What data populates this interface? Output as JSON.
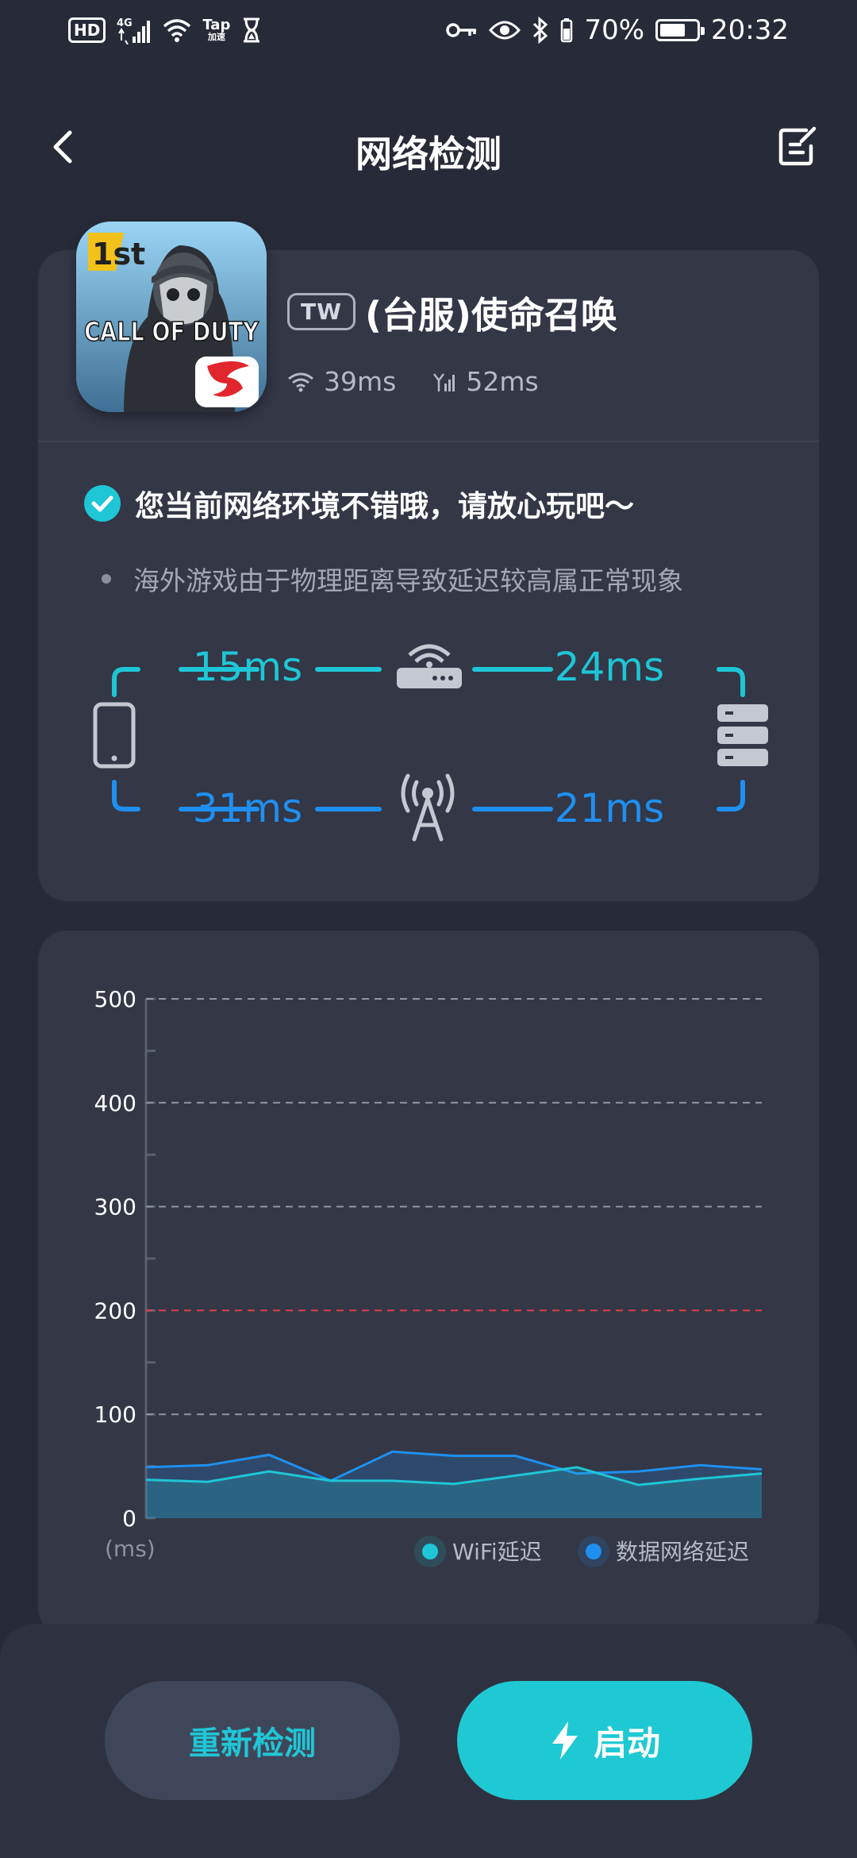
{
  "status_bar": {
    "hd": "HD",
    "network_type": "4G",
    "tap_top": "Tap",
    "tap_bottom": "加速",
    "battery_percent": "70%",
    "battery_level": 0.7,
    "time": "20:32"
  },
  "header": {
    "title": "网络检测"
  },
  "game": {
    "icon_logo_text": "CALL OF DUTY",
    "icon_badge_text": "1st",
    "region": "TW",
    "name": "(台服)使命召唤",
    "wifi_ping": "39ms",
    "cell_ping": "52ms"
  },
  "diagnosis": {
    "status": "您当前网络环境不错哦，请放心玩吧～",
    "note": "海外游戏由于物理距离导致延迟较高属正常现象"
  },
  "route": {
    "wifi_to_router": "15ms",
    "router_to_server": "24ms",
    "cell_to_tower": "31ms",
    "tower_to_server": "21ms"
  },
  "colors": {
    "accent": "#1ec6d6",
    "cellular": "#1f8ff0",
    "threshold": "#e0404a",
    "background": "#272b38",
    "card": "#333746"
  },
  "chart_data": {
    "type": "area",
    "ylim": [
      0,
      500
    ],
    "yticks": [
      "0",
      "100",
      "200",
      "300",
      "400",
      "500"
    ],
    "unit_label": "(ms)",
    "threshold": 200,
    "grid": true,
    "legend_position": "bottom-right",
    "series": [
      {
        "name": "WiFi延迟",
        "color": "#1ec6d6",
        "values": [
          37,
          35,
          45,
          36,
          36,
          33,
          41,
          49,
          32,
          38,
          43
        ]
      },
      {
        "name": "数据网络延迟",
        "color": "#1f8ff0",
        "values": [
          49,
          51,
          61,
          36,
          64,
          60,
          60,
          43,
          45,
          51,
          47
        ]
      }
    ]
  },
  "actions": {
    "retest": "重新检测",
    "launch": "启动"
  }
}
